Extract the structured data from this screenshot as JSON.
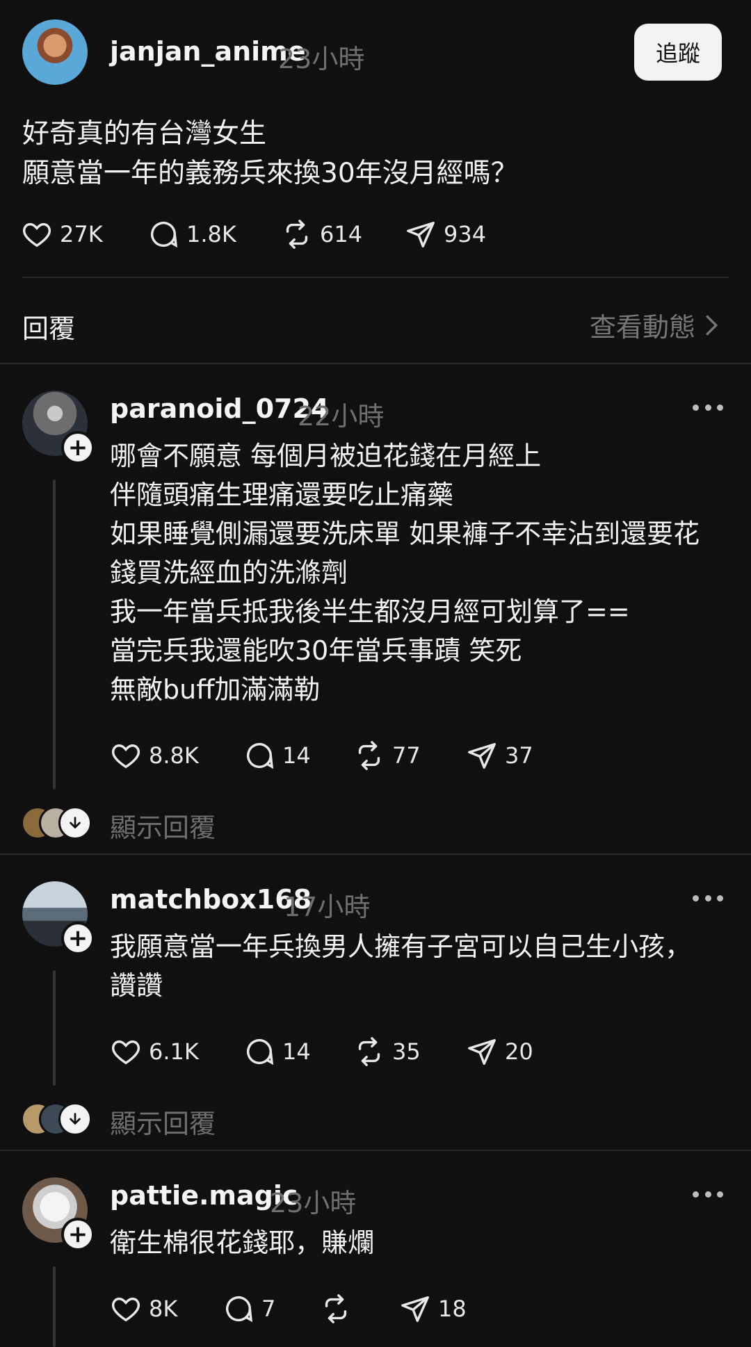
{
  "post": {
    "username": "janjan_anime",
    "time": "23小時",
    "follow_label": "追蹤",
    "text_lines": [
      "好奇真的有台灣女生",
      "願意當一年的義務兵來換30年沒月經嗎？"
    ],
    "likes": "27K",
    "comments": "1.8K",
    "reposts": "614",
    "shares": "934"
  },
  "replies_header": {
    "label": "回覆",
    "activity_label": "查看動態"
  },
  "comments": [
    {
      "username": "paranoid_0724",
      "time": "22小時",
      "text_lines": [
        "哪會不願意 每個月被迫花錢在月經上",
        "伴隨頭痛生理痛還要吃止痛藥",
        "如果睡覺側漏還要洗床單 如果褲子不幸沾到還要花",
        "錢買洗經血的洗滌劑",
        "我一年當兵抵我後半生都沒月經可划算了==",
        "當完兵我還能吹30年當兵事蹟 笑死",
        "無敵buff加滿滿勒"
      ],
      "likes": "8.8K",
      "comments": "14",
      "reposts": "77",
      "shares": "37",
      "show_replies": "顯示回覆"
    },
    {
      "username": "matchbox168",
      "time": "17小時",
      "text_lines": [
        "我願意當一年兵換男人擁有子宮可以自己生小孩，",
        "讚讚"
      ],
      "likes": "6.1K",
      "comments": "14",
      "reposts": "35",
      "shares": "20",
      "show_replies": "顯示回覆"
    },
    {
      "username": "pattie.magic",
      "time": "23小時",
      "text_lines": [
        "衛生棉很花錢耶，賺爛"
      ],
      "likes": "8K",
      "comments": "7",
      "reposts": "",
      "shares": "18"
    }
  ],
  "icons": {
    "like": "heart-icon",
    "comment": "comment-bubble-icon",
    "repost": "repost-icon",
    "share": "send-icon",
    "more": "more-dots-icon",
    "follow_badge": "plus-icon",
    "expand": "arrow-down-icon",
    "chevron": "chevron-right-icon"
  },
  "colors": {
    "background": "#101010",
    "text": "#f3f3f3",
    "muted": "#6f6f6f",
    "divider": "#2a2a2a",
    "button_bg": "#f3f3f3"
  }
}
